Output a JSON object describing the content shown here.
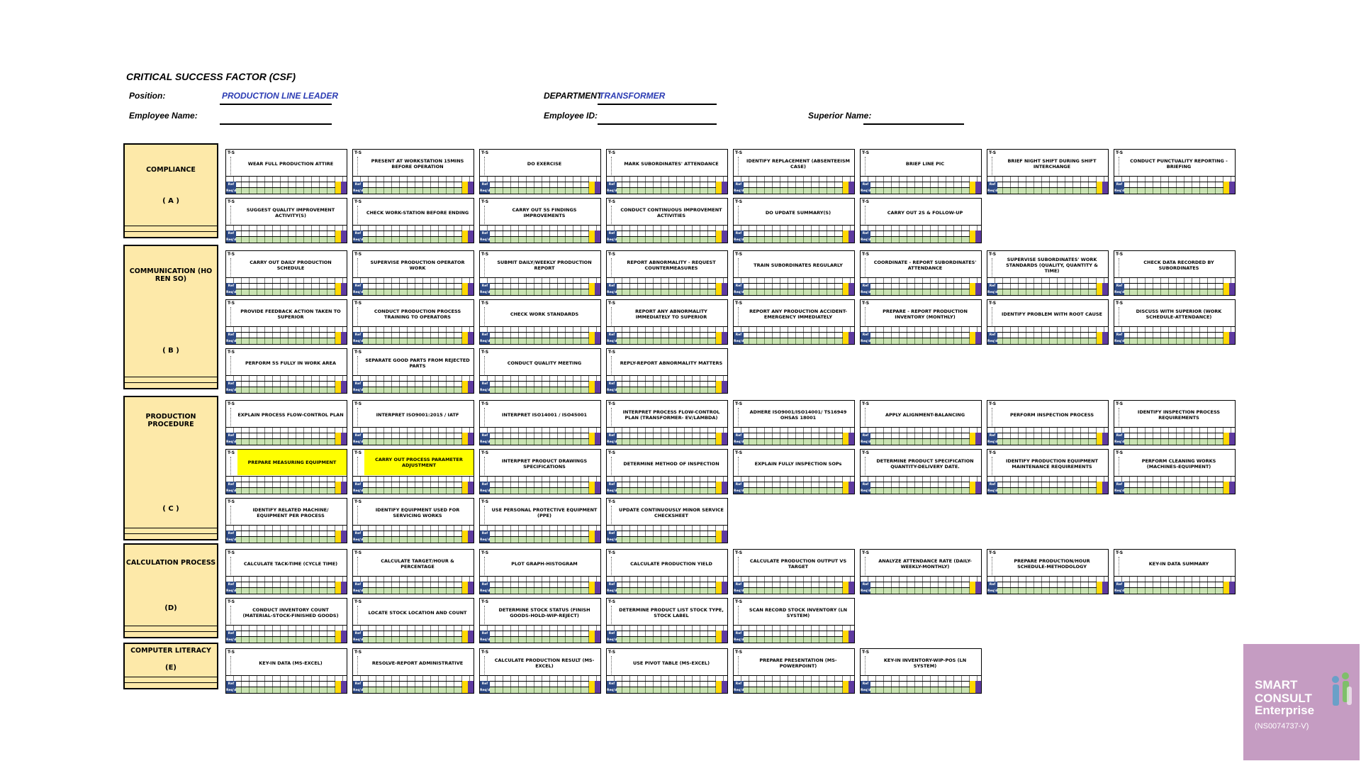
{
  "title": "CRITICAL SUCCESS FACTOR (CSF)",
  "header": {
    "position_label": "Position:",
    "position_value": "PRODUCTION LINE LEADER",
    "department_label": "DEPARTMENT:",
    "department_value": "TRANSFORMER",
    "employee_name_label": "Employee Name:",
    "employee_id_label": "Employee ID:",
    "superior_name_label": "Superior Name:"
  },
  "card_legend": {
    "level_label": "T-S",
    "row_label_1": "Ref",
    "row_label_2": "Req'd"
  },
  "categories": [
    {
      "name": "COMPLIANCE",
      "code": "( A )",
      "tasks": [
        {
          "label": "WEAR FULL PRODUCTION ATTIRE",
          "highlight": false
        },
        {
          "label": "PRESENT AT WORKSTATION 15MINS BEFORE OPERATION",
          "highlight": false
        },
        {
          "label": "DO EXERCISE",
          "highlight": false
        },
        {
          "label": "MARK SUBORDINATES' ATTENDANCE",
          "highlight": false
        },
        {
          "label": "IDENTIFY REPLACEMENT (ABSENTEEISM CASE)",
          "highlight": false
        },
        {
          "label": "BRIEF LINE PIC",
          "highlight": false
        },
        {
          "label": "BRIEF NIGHT SHIFT DURING SHIFT INTERCHANGE",
          "highlight": false
        },
        {
          "label": "CONDUCT PUNCTUALITY REPORTING - BRIEFING",
          "highlight": false
        },
        {
          "label": "SUGGEST QUALITY IMPROVEMENT ACTIVITY(S)",
          "highlight": false
        },
        {
          "label": "CHECK WORK-STATION BEFORE ENDING",
          "highlight": false
        },
        {
          "label": "CARRY OUT 5S FINDINGS IMPROVEMENTS",
          "highlight": false
        },
        {
          "label": "CONDUCT CONTINUOUS IMPROVEMENT ACTIVITIES",
          "highlight": false
        },
        {
          "label": "DO UPDATE SUMMARY(S)",
          "highlight": false
        },
        {
          "label": "CARRY OUT 2S & FOLLOW-UP",
          "highlight": false
        }
      ]
    },
    {
      "name": "COMMUNICATION (HO REN SO)",
      "code": "( B )",
      "tasks": [
        {
          "label": "CARRY OUT DAILY PRODUCTION SCHEDULE",
          "highlight": false
        },
        {
          "label": "SUPERVISE PRODUCTION OPERATOR WORK",
          "highlight": false
        },
        {
          "label": "SUBMIT DAILY/WEEKLY PRODUCTION REPORT",
          "highlight": false
        },
        {
          "label": "REPORT ABNORMALITY - REQUEST COUNTERMEASURES",
          "highlight": false
        },
        {
          "label": "TRAIN SUBORDINATES REGULARLY",
          "highlight": false
        },
        {
          "label": "COORDINATE - REPORT SUBORDINATES' ATTENDANCE",
          "highlight": false
        },
        {
          "label": "SUPERVISE SUBORDINATES' WORK STANDARDS (QUALITY, QUANTITY & TIME)",
          "highlight": false
        },
        {
          "label": "CHECK DATA RECORDED BY SUBORDINATES",
          "highlight": false
        },
        {
          "label": "PROVIDE FEEDBACK ACTION TAKEN TO SUPERIOR",
          "highlight": false
        },
        {
          "label": "CONDUCT PRODUCTION PROCESS TRAINING TO OPERATORS",
          "highlight": false
        },
        {
          "label": "CHECK WORK STANDARDS",
          "highlight": false
        },
        {
          "label": "REPORT ANY ABNORMALITY IMMEDIATELY TO SUPERIOR",
          "highlight": false
        },
        {
          "label": "REPORT ANY PRODUCTION ACCIDENT-EMERGENCY IMMEDIATELY",
          "highlight": false
        },
        {
          "label": "PREPARE - REPORT PRODUCTION INVENTORY (MONTHLY)",
          "highlight": false
        },
        {
          "label": "IDENTIFY PROBLEM WITH ROOT CAUSE",
          "highlight": false
        },
        {
          "label": "DISCUSS WITH SUPERIOR (WORK SCHEDULE-ATTENDANCE)",
          "highlight": false
        },
        {
          "label": "PERFORM 5S FULLY IN WORK AREA",
          "highlight": false
        },
        {
          "label": "SEPARATE GOOD PARTS FROM REJECTED PARTS",
          "highlight": false
        },
        {
          "label": "CONDUCT QUALITY MEETING",
          "highlight": false
        },
        {
          "label": "REPLY-REPORT ABNORMALITY MATTERS",
          "highlight": false
        }
      ]
    },
    {
      "name": "PRODUCTION PROCEDURE",
      "code": "( C )",
      "tasks": [
        {
          "label": "EXPLAIN PROCESS FLOW-CONTROL PLAN",
          "highlight": false
        },
        {
          "label": "INTERPRET ISO9001:2015 / IATF",
          "highlight": false
        },
        {
          "label": "INTERPRET ISO14001 / ISO45001",
          "highlight": false
        },
        {
          "label": "INTERPRET PROCESS FLOW-CONTROL PLAN (TRANSFORMER- EV/LAMBDA)",
          "highlight": false
        },
        {
          "label": "ADHERE ISO9001/ISO14001/ TS16949 OHSAS 18001",
          "highlight": false
        },
        {
          "label": "APPLY ALIGNMENT-BALANCING",
          "highlight": false
        },
        {
          "label": "PERFORM INSPECTION PROCESS",
          "highlight": false
        },
        {
          "label": "IDENTIFY INSPECTION PROCESS REQUIREMENTS",
          "highlight": false
        },
        {
          "label": "PREPARE MEASURING EQUIPMENT",
          "highlight": true
        },
        {
          "label": "CARRY OUT PROCESS PARAMETER ADJUSTMENT",
          "highlight": true
        },
        {
          "label": "INTERPRET PRODUCT DRAWINGS SPECIFICATIONS",
          "highlight": false
        },
        {
          "label": "DETERMINE METHOD OF INSPECTION",
          "highlight": false
        },
        {
          "label": "EXPLAIN FULLY INSPECTION SOPs",
          "highlight": false
        },
        {
          "label": "DETERMINE PRODUCT SPECIFICATION QUANTITY-DELIVERY DATE.",
          "highlight": false
        },
        {
          "label": "IDENTIFY PRODUCTION EQUIPMENT MAINTENANCE REQUIREMENTS",
          "highlight": false
        },
        {
          "label": "PERFORM CLEANING WORKS (MACHINES-EQUIPMENT)",
          "highlight": false
        },
        {
          "label": "IDENTIFY RELATED MACHINE/ EQUIPMENT PER PROCESS",
          "highlight": false
        },
        {
          "label": "IDENTIFY EQUIPMENT USED FOR SERVICING WORKS",
          "highlight": false
        },
        {
          "label": "USE PERSONAL PROTECTIVE EQUIPMENT (PPE)",
          "highlight": false
        },
        {
          "label": "UPDATE CONTINUOUSLY MINOR SERVICE CHECKSHEET",
          "highlight": false
        }
      ]
    },
    {
      "name": "CALCULATION PROCESS",
      "code": "(D)",
      "tasks": [
        {
          "label": "CALCULATE TACK-TIME (CYCLE TIME)",
          "highlight": false
        },
        {
          "label": "CALCULATE TARGET/HOUR & PERCENTAGE",
          "highlight": false
        },
        {
          "label": "PLOT GRAPH-HISTOGRAM",
          "highlight": false
        },
        {
          "label": "CALCULATE PRODUCTION YIELD",
          "highlight": false
        },
        {
          "label": "CALCULATE PRODUCTION OUTPUT VS TARGET",
          "highlight": false
        },
        {
          "label": "ANALYZE ATTENDANCE RATE (DAILY-WEEKLY-MONTHLY)",
          "highlight": false
        },
        {
          "label": "PREPARE PRODUCTION/HOUR SCHEDULE-METHODOLOGY",
          "highlight": false
        },
        {
          "label": "KEY-IN DATA SUMMARY",
          "highlight": false
        },
        {
          "label": "CONDUCT INVENTORY COUNT (MATERIAL-STOCK-FINISHED GOODS)",
          "highlight": false
        },
        {
          "label": "LOCATE STOCK LOCATION AND COUNT",
          "highlight": false
        },
        {
          "label": "DETERMINE STOCK STATUS (FINISH GOODS-HOLD-WIP-REJECT)",
          "highlight": false
        },
        {
          "label": "DETERMINE PRODUCT LIST STOCK TYPE, STOCK LABEL",
          "highlight": false
        },
        {
          "label": "SCAN RECORD STOCK INVENTORY (LN SYSTEM)",
          "highlight": false
        }
      ]
    },
    {
      "name": "COMPUTER LITERACY",
      "code": "(E)",
      "tasks": [
        {
          "label": "KEY-IN DATA (MS-EXCEL)",
          "highlight": false
        },
        {
          "label": "RESOLVE-REPORT ADMINISTRATIVE",
          "highlight": false
        },
        {
          "label": "CALCULATE PRODUCTION RESULT (MS-EXCEL)",
          "highlight": false
        },
        {
          "label": "USE PIVOT TABLE (MS-EXCEL)",
          "highlight": false
        },
        {
          "label": "PREPARE PRESENTATION (MS-POWERPOINT)",
          "highlight": false
        },
        {
          "label": "KEY-IN INVENTORY-WIP-POS (LN SYSTEM)",
          "highlight": false
        }
      ]
    }
  ],
  "logo": {
    "line1": "SMART",
    "line2": "CONSULT",
    "line3": "Enterprise",
    "registration": "(NS0074737-V)"
  },
  "colors": {
    "category_fill": "#fde9a9",
    "highlight": "#ffff00",
    "accent_text": "#2b3bb3",
    "logo_bg": "#c59cc2"
  }
}
